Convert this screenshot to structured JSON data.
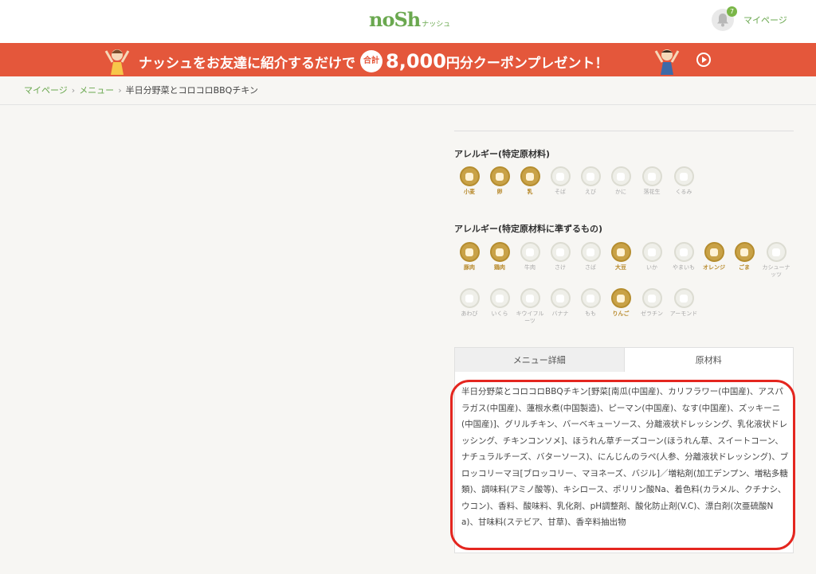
{
  "header": {
    "logo_main": "noSh",
    "logo_sub": "ナッシュ",
    "notification_count": "7",
    "mypage_label": "マイページ"
  },
  "banner": {
    "text_before": "ナッシュをお友達に紹介するだけで",
    "pill": "合計",
    "amount": "8,000",
    "text_after": "円分クーポンプレゼント！"
  },
  "breadcrumb": {
    "items": [
      "マイページ",
      "メニュー",
      "半日分野菜とコロコロBBQチキン"
    ]
  },
  "allergens": {
    "title": "アレルギー(特定原材料)",
    "items": [
      {
        "label": "小麦",
        "active": true
      },
      {
        "label": "卵",
        "active": true
      },
      {
        "label": "乳",
        "active": true
      },
      {
        "label": "そば",
        "active": false
      },
      {
        "label": "えび",
        "active": false
      },
      {
        "label": "かに",
        "active": false
      },
      {
        "label": "落花生",
        "active": false
      },
      {
        "label": "くるみ",
        "active": false
      }
    ]
  },
  "allergens_sub": {
    "title": "アレルギー(特定原材料に準ずるもの)",
    "items": [
      {
        "label": "豚肉",
        "active": true
      },
      {
        "label": "鶏肉",
        "active": true
      },
      {
        "label": "牛肉",
        "active": false
      },
      {
        "label": "さけ",
        "active": false
      },
      {
        "label": "さば",
        "active": false
      },
      {
        "label": "大豆",
        "active": true
      },
      {
        "label": "いか",
        "active": false
      },
      {
        "label": "やまいも",
        "active": false
      },
      {
        "label": "オレンジ",
        "active": true
      },
      {
        "label": "ごま",
        "active": true
      },
      {
        "label": "カシューナッツ",
        "active": false
      },
      {
        "label": "あわび",
        "active": false
      },
      {
        "label": "いくら",
        "active": false
      },
      {
        "label": "キウイフルーツ",
        "active": false
      },
      {
        "label": "バナナ",
        "active": false
      },
      {
        "label": "もも",
        "active": false
      },
      {
        "label": "りんご",
        "active": true
      },
      {
        "label": "ゼラチン",
        "active": false
      },
      {
        "label": "アーモンド",
        "active": false
      }
    ]
  },
  "tabs": [
    {
      "label": "メニュー詳細",
      "active": false
    },
    {
      "label": "原材料",
      "active": true
    }
  ],
  "ingredients_text": "半日分野菜とコロコロBBQチキン[野菜[南瓜(中国産)、カリフラワー(中国産)、アスパラガス(中国産)、蓮根水煮(中国製造)、ピーマン(中国産)、なす(中国産)、ズッキーニ(中国産)]、グリルチキン、バーベキューソース、分離液状ドレッシング、乳化液状ドレッシング、チキンコンソメ]、ほうれん草チーズコーン(ほうれん草、スイートコーン、ナチュラルチーズ、バターソース)、にんじんのラペ(人参、分離液状ドレッシング)、ブロッコリーマヨ[ブロッコリー、マヨネーズ、バジル]／増粘剤(加工デンプン、増粘多糖類)、調味料(アミノ酸等)、キシロース、ポリリン酸Na、着色料(カラメル、クチナシ、ウコン)、香料、酸味料、乳化剤、pH調整剤、酸化防止剤(V.C)、漂白剤(次亜硫酸Na)、甘味料(ステビア、甘草)、香辛料抽出物",
  "colors": {
    "brand_green": "#6aa84f",
    "banner_red": "#e4573b",
    "allergen_gold": "#c9a247",
    "highlight_red": "#e4261f"
  }
}
